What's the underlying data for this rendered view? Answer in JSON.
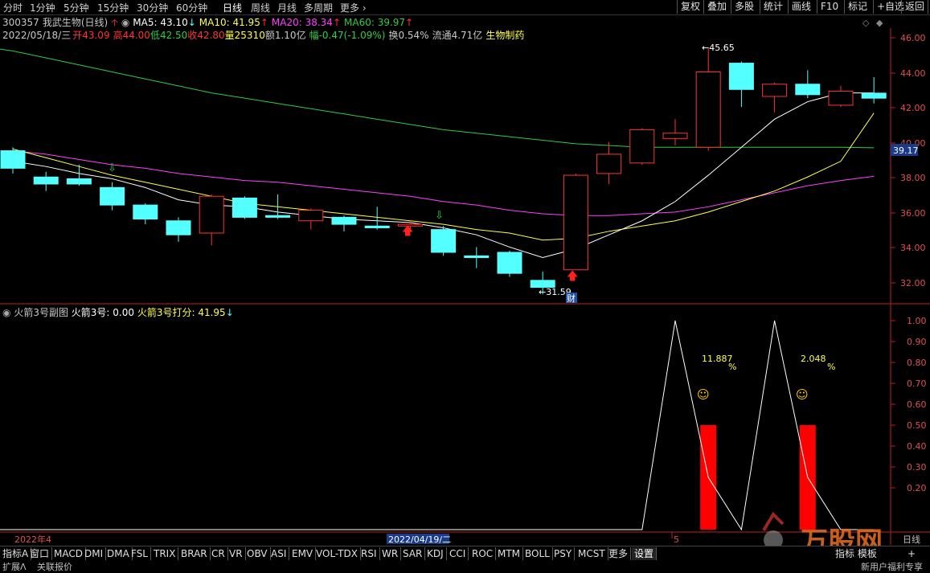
{
  "period_tabs": [
    {
      "label": "分时"
    },
    {
      "label": "1分钟"
    },
    {
      "label": "5分钟"
    },
    {
      "label": "15分钟"
    },
    {
      "label": "30分钟"
    },
    {
      "label": "60分钟"
    },
    {
      "label": "日线"
    },
    {
      "label": "周线"
    },
    {
      "label": "月线"
    },
    {
      "label": "多周期"
    },
    {
      "label": "更多"
    }
  ],
  "right_buttons": [
    {
      "label": "复权"
    },
    {
      "label": "叠加"
    },
    {
      "label": "多股"
    },
    {
      "label": "统计"
    },
    {
      "label": "画线"
    },
    {
      "label": "F10"
    },
    {
      "label": "标记"
    },
    {
      "label": "+自选"
    },
    {
      "label": "返回"
    }
  ],
  "header": {
    "stock_code": "300357",
    "stock_name": "我武生物(日线)",
    "ma5": "MA5: 43.10",
    "ma10": "MA10: 41.95",
    "ma20": "MA20: 38.34",
    "ma60": "MA60: 39.97"
  },
  "info": {
    "date": "2022/05/18/三",
    "open": "开43.09",
    "high": "高44.00",
    "low": "低42.50",
    "close": "收42.80",
    "volume": "量25310",
    "amount": "额1.10亿",
    "change": "幅-0.47(-1.09%)",
    "turnover": "换0.54%",
    "float_cap": "流通4.71亿",
    "sector": "生物制药"
  },
  "colors": {
    "up": "#ff3232",
    "down": "#54ffff",
    "ma5": "#ffffff",
    "ma10": "#ffff4c",
    "ma20": "#ff40ff",
    "ma60": "#2ecc40",
    "axis_red": "#c02020"
  },
  "price_axis": {
    "ticks": [
      "46.00",
      "44.00",
      "42.00",
      "40.00",
      "38.00",
      "36.00",
      "34.00",
      "32.00"
    ],
    "current": "39.17"
  },
  "annotations": {
    "high": "45.65",
    "low": "31.59",
    "cai": "财"
  },
  "chart_data": {
    "type": "candlestick",
    "ylim": [
      31.2,
      46.8
    ],
    "candles": [
      {
        "o": 39.8,
        "h": 40.0,
        "l": 38.5,
        "c": 38.8
      },
      {
        "o": 38.3,
        "h": 38.6,
        "l": 37.5,
        "c": 37.9
      },
      {
        "o": 38.2,
        "h": 39.0,
        "l": 37.8,
        "c": 37.9
      },
      {
        "o": 37.7,
        "h": 38.0,
        "l": 36.4,
        "c": 36.7
      },
      {
        "o": 36.7,
        "h": 36.8,
        "l": 35.6,
        "c": 35.9
      },
      {
        "o": 35.8,
        "h": 36.0,
        "l": 34.6,
        "c": 35.0
      },
      {
        "o": 35.1,
        "h": 37.3,
        "l": 34.4,
        "c": 37.2
      },
      {
        "o": 37.1,
        "h": 37.2,
        "l": 35.9,
        "c": 36.0
      },
      {
        "o": 36.1,
        "h": 37.3,
        "l": 35.9,
        "c": 36.0
      },
      {
        "o": 35.8,
        "h": 36.5,
        "l": 35.3,
        "c": 36.4
      },
      {
        "o": 36.0,
        "h": 36.1,
        "l": 35.2,
        "c": 35.6
      },
      {
        "o": 35.5,
        "h": 36.6,
        "l": 35.3,
        "c": 35.4
      },
      {
        "o": 35.5,
        "h": 35.8,
        "l": 35.3,
        "c": 35.6
      },
      {
        "o": 35.3,
        "h": 35.5,
        "l": 33.8,
        "c": 34.0
      },
      {
        "o": 33.8,
        "h": 34.3,
        "l": 33.1,
        "c": 33.7
      },
      {
        "o": 34.0,
        "h": 34.1,
        "l": 32.6,
        "c": 32.8
      },
      {
        "o": 32.4,
        "h": 32.9,
        "l": 31.6,
        "c": 32.0
      },
      {
        "o": 33.0,
        "h": 38.5,
        "l": 33.0,
        "c": 38.4
      },
      {
        "o": 38.5,
        "h": 40.3,
        "l": 37.9,
        "c": 39.6
      },
      {
        "o": 39.1,
        "h": 41.1,
        "l": 39.0,
        "c": 41.0
      },
      {
        "o": 40.5,
        "h": 41.6,
        "l": 40.1,
        "c": 40.8
      },
      {
        "o": 40.0,
        "h": 45.65,
        "l": 39.8,
        "c": 44.3
      },
      {
        "o": 44.8,
        "h": 44.9,
        "l": 42.3,
        "c": 43.3
      },
      {
        "o": 42.9,
        "h": 43.7,
        "l": 42.0,
        "c": 43.6
      },
      {
        "o": 43.6,
        "h": 44.4,
        "l": 42.8,
        "c": 43.0
      },
      {
        "o": 42.4,
        "h": 43.5,
        "l": 42.3,
        "c": 43.2
      },
      {
        "o": 43.09,
        "h": 44.0,
        "l": 42.5,
        "c": 42.8
      }
    ],
    "ma5": [
      39.2,
      38.9,
      38.5,
      38.2,
      37.7,
      37.0,
      36.7,
      36.6,
      36.3,
      36.1,
      35.9,
      35.8,
      35.7,
      35.4,
      35.0,
      34.3,
      33.7,
      34.2,
      35.0,
      35.8,
      36.9,
      38.4,
      40.0,
      41.6,
      42.6,
      43.1,
      43.1
    ],
    "ma10": [
      39.9,
      39.4,
      38.9,
      38.4,
      38.0,
      37.6,
      37.2,
      36.8,
      36.6,
      36.4,
      36.2,
      36.0,
      35.8,
      35.6,
      35.3,
      35.1,
      34.7,
      34.8,
      35.2,
      35.5,
      35.8,
      36.3,
      36.9,
      37.5,
      38.3,
      39.2,
      41.95
    ],
    "ma20": [
      39.8,
      39.6,
      39.3,
      39.0,
      38.8,
      38.5,
      38.3,
      38.1,
      38.0,
      37.8,
      37.6,
      37.4,
      37.2,
      36.9,
      36.7,
      36.4,
      36.2,
      36.1,
      36.1,
      36.2,
      36.3,
      36.6,
      37.0,
      37.4,
      37.8,
      38.1,
      38.34
    ],
    "ma60": [
      45.5,
      45.1,
      44.7,
      44.3,
      43.9,
      43.5,
      43.1,
      42.8,
      42.5,
      42.2,
      41.9,
      41.6,
      41.3,
      41.0,
      40.8,
      40.6,
      40.4,
      40.2,
      40.1,
      40.0,
      40.0,
      40.0,
      40.0,
      40.0,
      40.0,
      40.0,
      39.97
    ]
  },
  "sub_indicator": {
    "name": "火箭3号副图",
    "value": "火箭3号: 0.00",
    "score": "火箭3号打分: 41.95",
    "ticks": [
      "1.00",
      "0.90",
      "0.80",
      "0.70",
      "0.60",
      "0.50",
      "0.40",
      "0.30",
      "0.20"
    ],
    "pct1": "11.887",
    "pct2": "2.048",
    "pct_sym": "%",
    "smile": "☺",
    "line": [
      0,
      0,
      0,
      0,
      0,
      0,
      0,
      0,
      0,
      0,
      0,
      0,
      0,
      0,
      0,
      0,
      0,
      0,
      0,
      0,
      1.0,
      0.25,
      0,
      1.0,
      0.25,
      0,
      0
    ],
    "bars": [
      {
        "idx": 21,
        "value": 0.5
      },
      {
        "idx": 24,
        "value": 0.5
      }
    ]
  },
  "date_axis": {
    "left": "2022年4",
    "mid": "2022/04/19/二",
    "month5": "5",
    "right": "日线"
  },
  "bottom_tabs": [
    {
      "label": "指标A"
    },
    {
      "label": "窗口"
    },
    {
      "label": "MACD"
    },
    {
      "label": "DMI"
    },
    {
      "label": "DMA"
    },
    {
      "label": "FSL"
    },
    {
      "label": "TRIX"
    },
    {
      "label": "BRAR"
    },
    {
      "label": "CR"
    },
    {
      "label": "VR"
    },
    {
      "label": "OBV"
    },
    {
      "label": "ASI"
    },
    {
      "label": "EMV"
    },
    {
      "label": "VOL-TDX"
    },
    {
      "label": "RSI"
    },
    {
      "label": "WR"
    },
    {
      "label": "SAR"
    },
    {
      "label": "KDJ"
    },
    {
      "label": "CCI"
    },
    {
      "label": "ROC"
    },
    {
      "label": "MTM"
    },
    {
      "label": "BOLL"
    },
    {
      "label": "PSY"
    },
    {
      "label": "MCST"
    },
    {
      "label": "更多"
    },
    {
      "label": "设置"
    }
  ],
  "bottom_right": {
    "template": "指标 模板",
    "plus": "+"
  },
  "status": {
    "left1": "扩展Λ",
    "left2": "关联报价",
    "right": "新用户福利专享"
  },
  "watermark": "万股网"
}
